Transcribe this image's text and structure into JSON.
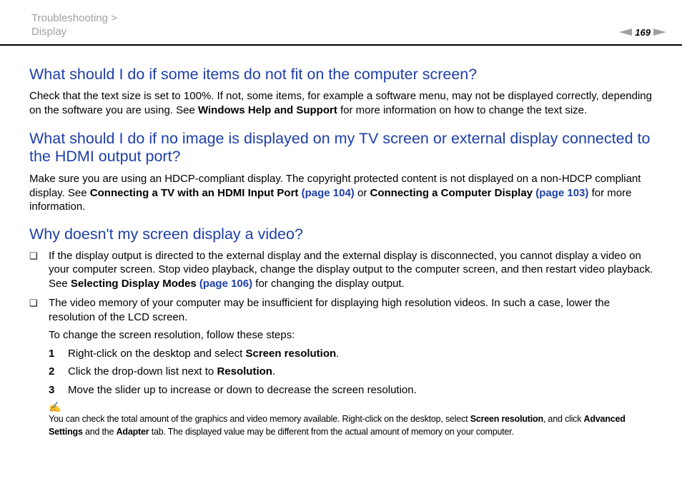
{
  "header": {
    "breadcrumb_line1": "Troubleshooting >",
    "breadcrumb_line2": "Display",
    "page_number": "169"
  },
  "section1": {
    "heading": "What should I do if some items do not fit on the computer screen?",
    "p_a": "Check that the text size is set to 100%. If not, some items, for example a software menu, may not be displayed correctly, depending on the software you are using. See ",
    "p_b": "Windows Help and Support",
    "p_c": " for more information on how to change the text size."
  },
  "section2": {
    "heading": "What should I do if no image is displayed on my TV screen or external display connected to the HDMI output port?",
    "p_a": "Make sure you are using an HDCP-compliant display. The copyright protected content is not displayed on a non-HDCP compliant display. See ",
    "p_b": "Connecting a TV with an HDMI Input Port",
    "p_c": " ",
    "link1": "(page 104)",
    "p_d": " or ",
    "p_e": "Connecting a Computer Display",
    "p_f": " ",
    "link2": "(page 103)",
    "p_g": " for more information."
  },
  "section3": {
    "heading": "Why doesn't my screen display a video?",
    "bullet_symbol": "❑",
    "bullet1_a": "If the display output is directed to the external display and the external display is disconnected, you cannot display a video on your computer screen. Stop video playback, change the display output to the computer screen, and then restart video playback. See ",
    "bullet1_b": "Selecting Display Modes",
    "bullet1_c": " ",
    "bullet1_link": "(page 106)",
    "bullet1_d": " for changing the display output.",
    "bullet2": "The video memory of your computer may be insufficient for displaying high resolution videos. In such a case, lower the resolution of the LCD screen.",
    "steps_intro": "To change the screen resolution, follow these steps:",
    "steps": [
      {
        "num": "1",
        "a": "Right-click on the desktop and select ",
        "b": "Screen resolution",
        "c": "."
      },
      {
        "num": "2",
        "a": "Click the drop-down list next to ",
        "b": "Resolution",
        "c": "."
      },
      {
        "num": "3",
        "a": "Move the slider up to increase or down to decrease the screen resolution.",
        "b": "",
        "c": ""
      }
    ],
    "note_icon": "✍",
    "note_a": "You can check the total amount of the graphics and video memory available. Right-click on the desktop, select ",
    "note_b": "Screen resolution",
    "note_c": ", and click ",
    "note_d": "Advanced Settings",
    "note_e": " and the ",
    "note_f": "Adapter",
    "note_g": " tab. The displayed value may be different from the actual amount of memory on your computer."
  }
}
